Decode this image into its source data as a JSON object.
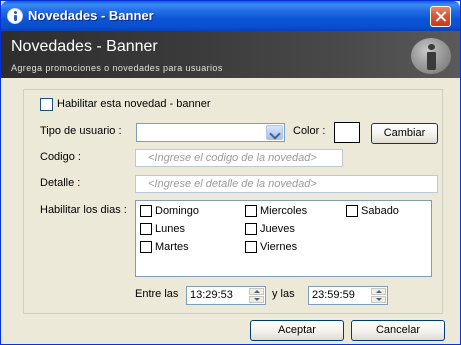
{
  "window": {
    "title": "Novedades - Banner"
  },
  "header": {
    "title": "Novedades - Banner",
    "subtitle": "Agrega promociones o novedades para usuarios"
  },
  "form": {
    "enable_label": "Habilitar esta novedad - banner",
    "user_type_label": "Tipo de usuario :",
    "user_type_value": "",
    "color_label": "Color :",
    "change_button": "Cambiar",
    "code_label": "Codigo :",
    "code_placeholder": "<Ingrese el codigo de la novedad>",
    "detail_label": "Detalle :",
    "detail_placeholder": "<Ingrese el detalle de la novedad>",
    "days_label": "Habilitar los dias :",
    "days": {
      "domingo": "Domingo",
      "lunes": "Lunes",
      "martes": "Martes",
      "miercoles": "Miercoles",
      "jueves": "Jueves",
      "viernes": "Viernes",
      "sabado": "Sabado"
    },
    "between_label": "Entre las",
    "and_label": "y las",
    "start_time": "13:29:53",
    "end_time": "23:59:59"
  },
  "footer": {
    "accept_button": "Aceptar",
    "cancel_button": "Cancelar"
  },
  "icons": [
    "app-info-icon",
    "close-icon",
    "info-icon",
    "dropdown-arrow-icon",
    "spin-up-icon",
    "spin-down-icon"
  ]
}
